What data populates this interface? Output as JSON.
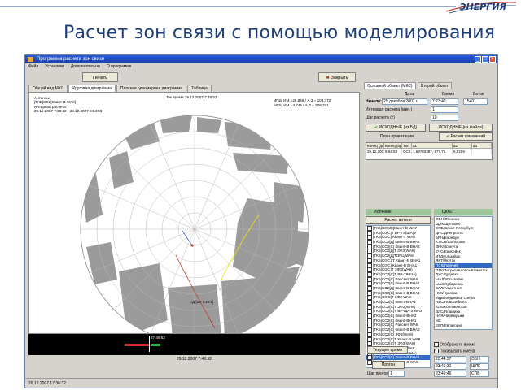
{
  "slide": {
    "title": "Расчет зон связи с помощью моделирования",
    "logo_text": "ЭНЕРГИЯ"
  },
  "window": {
    "title": "Программа расчета зон связи",
    "menu": [
      "Файл",
      "Установки",
      "Дополнительно",
      "О программе"
    ],
    "toolbar": {
      "calc_label": "Печать",
      "close_label": "Закрыть"
    },
    "tabs": [
      "Общий вид МКС",
      "Круговая диаграмма",
      "Плоская одномерная диаграмма",
      "Таблица"
    ],
    "active_tab": 1,
    "status_text": "29.12.2007 17:36:32"
  },
  "plot": {
    "info_left": [
      "Антенны:",
      "[ТКБ]СО2[Квинт-В WA8]",
      "Интервал расчета:",
      "29.12.2007 7:23:42 - 29.12.2007 8:54:53"
    ],
    "current_time": "Тек.время 29.12.2007 7:48:52",
    "coords_line1": "ИПД: ИМ =26,848    / А,З = 103,472",
    "coords_line2": "МСК: ИМ =4,745     / А,З = 306,321",
    "marker_label": "Т/Д [29 7:48:5]",
    "timeline_label": "29.12.2007 7:48:52",
    "timeline_marker": "67,49:52"
  },
  "right": {
    "tabs": [
      "Основной объект (МКС)",
      "Второй объект"
    ],
    "date_header": "Дата",
    "time_header": "Время",
    "step_header": "Виток",
    "start_label": "Начало:",
    "start_date": "29 декабря 2007 г.",
    "start_time": "7:23:42",
    "start_orbit": "15401",
    "interval_label": "Интервал расчета (мин.)",
    "interval_value": "1",
    "step_label": "Шаг расчета (с)",
    "step_value": "10",
    "btn_initial_db": "ИСХОДНЫЕ (из БД)",
    "btn_initial_file": "ИСХОДНЫЕ (из Файла)",
    "orient_label": "План ориентации",
    "btn_calc_changed": "Расчет изменений",
    "table_headers": [
      "Конец (дата)",
      "Конец (время)",
      "Тип",
      "a1",
      "a2",
      "a3"
    ],
    "table_row": [
      "29.12.2007",
      "8:54:53",
      "ОСК",
      "1,68740387,-177,76",
      "6,9259",
      ""
    ],
    "sources_label": "Источник:",
    "btn_calc_sources": "Расчет антенн",
    "targets_label": "Цель:",
    "sources": [
      "[ТКБ]С0[МК]Квинт-В WA7",
      "[ТКБ]С0[С]Т ВР-Т8(ША)V",
      "[ТКБ]С0[С] Квант-У WA8",
      "[ТКБ]СО2[Д] Квинт-В ВНА2",
      "[ТКБ]СО2[С] Квинт-В ВНА2",
      "[ТКБ]СО2[Д]Т ЗФЗ(WA8)",
      "[ТКБ]СО2[Д]ТОРЦ WA8",
      "[ТКБ]С0[С] Т Квант-В ВНА1",
      "[ТКБ]С0[С] Квант-В ВНА1",
      "[ТКБ]С0[С]Т ЗФЗ(WA8)",
      "[ТКБ]СО2[С]Т ВР-Т8(ША)",
      "[ТКБ]СО2[С] Рассвет WA8",
      "[ТКБ]СО2[С] Квинт-В ВНА1",
      "[ТКБ]СО2[Д] Квант-В ВНА2",
      "[ТКБ]СО2[С] Квант-В ВНА1",
      "[ТКБ]С0[С]Т ЗФЗ WA8",
      "[ТКБ]СО2[С] Квест-ВНА1",
      "[ТКБ]СО2[С]Т ЗФЗ(WA8)",
      "[ТКБ]СО2[С]Т ВР-ЩА-2 WA2",
      "[ТКБ]СО2[С] Квинт-ВНА2",
      "[ТКБ]СО2[С] Квинт-ВНА1",
      "[ТКБ]СО2[С] Рассвет WA8",
      "[ТКБ]СО2[С] Квант-В ВНА2",
      "[ТКБ]СО2[С] ЗФЗ(WA8)",
      "[ТКБ]СО2[С]Т Квант-В WA8",
      "[ТКБ]СО2[С]Т ЗФЗ(WA8)",
      "[ТКБ]СО2[С] ТОРЦ WA8",
      "[ТКБ]СО2[С]Т ВР-Т8(ША)",
      "[ТКБ]СО2[С] Квант-В ВНА1",
      "[ТКБ]СО2[С] Квинт-В WA8"
    ],
    "sources_checked": [
      0,
      0,
      0,
      0,
      0,
      0,
      0,
      0,
      0,
      0,
      0,
      0,
      0,
      1,
      0,
      1,
      0,
      0,
      0,
      0,
      0,
      0,
      0,
      0,
      0,
      0,
      0,
      0,
      1,
      0
    ],
    "sources_selected": 28,
    "targets": [
      "ОБН/Обнинск",
      "ЩЛК/Щёлково",
      "СПБ/Санкт-Петербург",
      "ДНС/Днепрорть",
      "БРН/Барнаул",
      "К.ПСК/Шолохово",
      "ВРК/Воркута",
      "ЕЧС/Енисейск",
      "ИТД/Алькийдк",
      "ЯКТ/Якутск",
      "ПСК/Горячий",
      "ПТК/Петропавловск-Камчатск",
      "ДУС/Дудевка",
      "ЫАЛ/Усть-Чайю",
      "ЫАЗ/Хубаревка",
      "ВАЛ/Алуштнис",
      "ЧУК/Чукотка",
      "МДВ/Медвежьи Озёра",
      "НВС/Новосибирск",
      "КОЕ/Коломенское",
      "ВЛС/Ялашиха",
      "ЧАЯ/Черёмушки",
      "МС",
      "ЕВП/Евпатория"
    ],
    "targets_selected": 10,
    "btn_current_time": "Текущее время",
    "btn_forecast": "Прогон",
    "forecast_step_label": "Шаг прогона",
    "forecast_step_value": "1",
    "display_time_label": "Отображать время",
    "show_names_label": "Показывать имена",
    "bottom_fields": [
      [
        "23:44:57",
        "ОБН"
      ],
      [
        "23:46:31",
        "ЩЛК"
      ],
      [
        "23:49:46",
        "СПБ"
      ]
    ]
  },
  "colors": {
    "title": "#1c3d7a",
    "titlebar": "#1c3ea8",
    "group_head": "#9bc79b",
    "selection": "#316ac5",
    "zone_fill": "#9b9b9b",
    "grid": "#b8b8b8"
  }
}
